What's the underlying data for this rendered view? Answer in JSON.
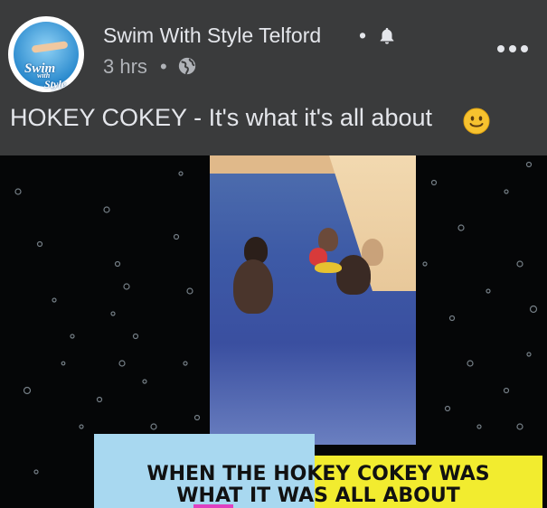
{
  "post": {
    "avatar": {
      "logo_text_line1": "Swim",
      "logo_text_line2": "with",
      "logo_text_line3": "Style"
    },
    "page_name": "Swim With Style Telford",
    "separator": "•",
    "notification_icon": "bell-icon",
    "time": "3 hrs",
    "privacy_icon": "globe-icon",
    "more_icon": "more-horizontal-icon",
    "caption": "HOKEY COKEY - It's what it's all about",
    "caption_emoji": "smiling-face-icon"
  },
  "video": {
    "banner_line1": "WHEN THE HOKEY COKEY WAS",
    "banner_line2": "WHAT IT WAS ALL ABOUT",
    "colors": {
      "banner_left": "#a8d8f0",
      "banner_right": "#f2ec2f",
      "accent": "#e040c0"
    }
  },
  "colors": {
    "background": "#3a3b3c",
    "primary_text": "#e4e6eb",
    "secondary_text": "#b0b3b8"
  }
}
